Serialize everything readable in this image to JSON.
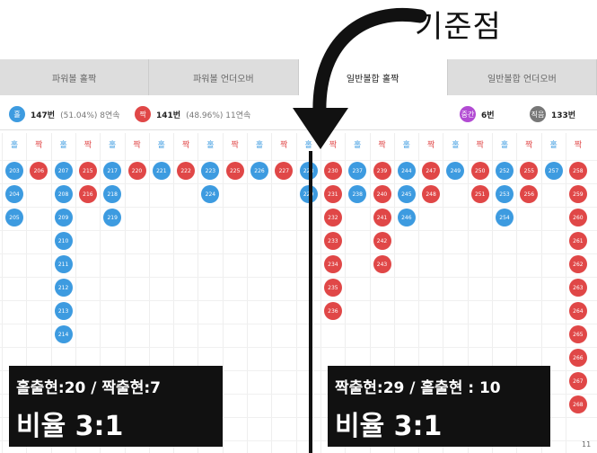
{
  "top_label": "기준점",
  "tabs": [
    {
      "label": "파워볼 홀짝",
      "active": false
    },
    {
      "label": "파워볼 언더오버",
      "active": false
    },
    {
      "label": "일반볼합 홀짝",
      "active": true
    },
    {
      "label": "일반볼합 언더오버",
      "active": false
    }
  ],
  "summary": {
    "odd": {
      "icon": "홀",
      "count": "147번",
      "pct": "(51.04%) 8연속",
      "color": "#3d9be0"
    },
    "even": {
      "icon": "짝",
      "count": "141번",
      "pct": "(48.96%) 11연속",
      "color": "#e04747"
    },
    "middle": {
      "icon": "중간",
      "count": "6번",
      "color": "#b24bd3"
    },
    "unknown": {
      "icon": "직음",
      "count": "133번",
      "color": "#777777"
    }
  },
  "columns": [
    {
      "head": "홀",
      "color": "blue",
      "balls": [
        "203",
        "204",
        "205"
      ]
    },
    {
      "head": "짝",
      "color": "red",
      "balls": [
        "206"
      ]
    },
    {
      "head": "홀",
      "color": "blue",
      "balls": [
        "207",
        "208",
        "209",
        "210",
        "211",
        "212",
        "213",
        "214"
      ]
    },
    {
      "head": "짝",
      "color": "red",
      "balls": [
        "215",
        "216"
      ]
    },
    {
      "head": "홀",
      "color": "blue",
      "balls": [
        "217",
        "218",
        "219"
      ]
    },
    {
      "head": "짝",
      "color": "red",
      "balls": [
        "220"
      ]
    },
    {
      "head": "홀",
      "color": "blue",
      "balls": [
        "221"
      ]
    },
    {
      "head": "짝",
      "color": "red",
      "balls": [
        "222"
      ]
    },
    {
      "head": "홀",
      "color": "blue",
      "balls": [
        "223",
        "224"
      ]
    },
    {
      "head": "짝",
      "color": "red",
      "balls": [
        "225"
      ]
    },
    {
      "head": "홀",
      "color": "blue",
      "balls": [
        "226"
      ]
    },
    {
      "head": "짝",
      "color": "red",
      "balls": [
        "227"
      ]
    },
    {
      "head": "홀",
      "color": "blue",
      "balls": [
        "228",
        "229"
      ]
    },
    {
      "head": "짝",
      "color": "red",
      "balls": [
        "230",
        "231",
        "232",
        "233",
        "234",
        "235",
        "236"
      ]
    },
    {
      "head": "홀",
      "color": "blue",
      "balls": [
        "237",
        "238"
      ]
    },
    {
      "head": "짝",
      "color": "red",
      "balls": [
        "239",
        "240",
        "241",
        "242",
        "243"
      ]
    },
    {
      "head": "홀",
      "color": "blue",
      "balls": [
        "244",
        "245",
        "246"
      ]
    },
    {
      "head": "짝",
      "color": "red",
      "balls": [
        "247",
        "248"
      ]
    },
    {
      "head": "홀",
      "color": "blue",
      "balls": [
        "249"
      ]
    },
    {
      "head": "짝",
      "color": "red",
      "balls": [
        "250",
        "251"
      ]
    },
    {
      "head": "홀",
      "color": "blue",
      "balls": [
        "252",
        "253",
        "254"
      ]
    },
    {
      "head": "짝",
      "color": "red",
      "balls": [
        "255",
        "256"
      ]
    },
    {
      "head": "홀",
      "color": "blue",
      "balls": [
        "257"
      ]
    },
    {
      "head": "짝",
      "color": "red",
      "balls": [
        "258",
        "259",
        "260",
        "261",
        "262",
        "263",
        "264",
        "265",
        "266",
        "267",
        "268"
      ]
    }
  ],
  "overlay_left": {
    "line1": "홀출현:20 / 짝출현:7",
    "line2": "비율 3:1"
  },
  "overlay_right": {
    "line1": "짝출현:29 / 홀출현 : 10",
    "line2": "비율 3:1"
  },
  "page_num": "11"
}
